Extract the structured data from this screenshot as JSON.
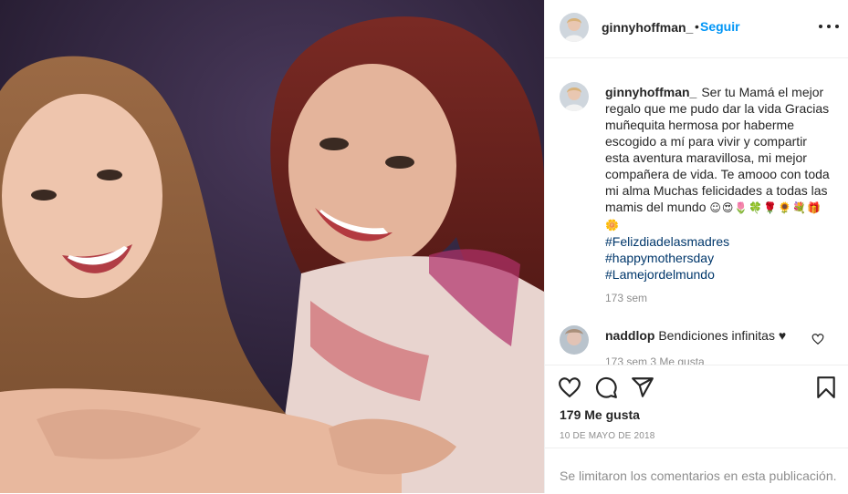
{
  "post": {
    "username": "ginnyhoffman_",
    "follow_label": "Seguir",
    "dot": "•",
    "caption_text": "Ser tu Mamá el mejor regalo que me pudo dar la vida Gracias muñequita hermosa por haberme escogido a mí para vivir y compartir esta aventura maravillosa, mi mejor compañera de vida. Te amooo con toda mi alma Muchas felicidades a todas las mamis del mundo",
    "caption_emojis": "☺😍🌷🍀🌹🌻💐🎁🌼",
    "hashtags": [
      "#Felizdiadelasmadres",
      "#happymothersday",
      "#Lamejordelmundo"
    ],
    "caption_time": "173 sem",
    "likes": "179 Me gusta",
    "date": "10 DE MAYO DE 2018",
    "comments_limited": "Se limitaron los comentarios en esta publicación."
  },
  "comment": {
    "username": "naddlop",
    "text": "Bendiciones infinitas ♥",
    "meta_partial": "173 sem   3 Me gusta"
  },
  "icons": {
    "more": "more-options-icon",
    "like": "heart-icon",
    "comment": "comment-icon",
    "share": "share-icon",
    "save": "bookmark-icon"
  },
  "colors": {
    "accent": "#0095f6",
    "hashtag": "#00376b",
    "muted": "#8e8e8e",
    "border": "#efefef"
  }
}
